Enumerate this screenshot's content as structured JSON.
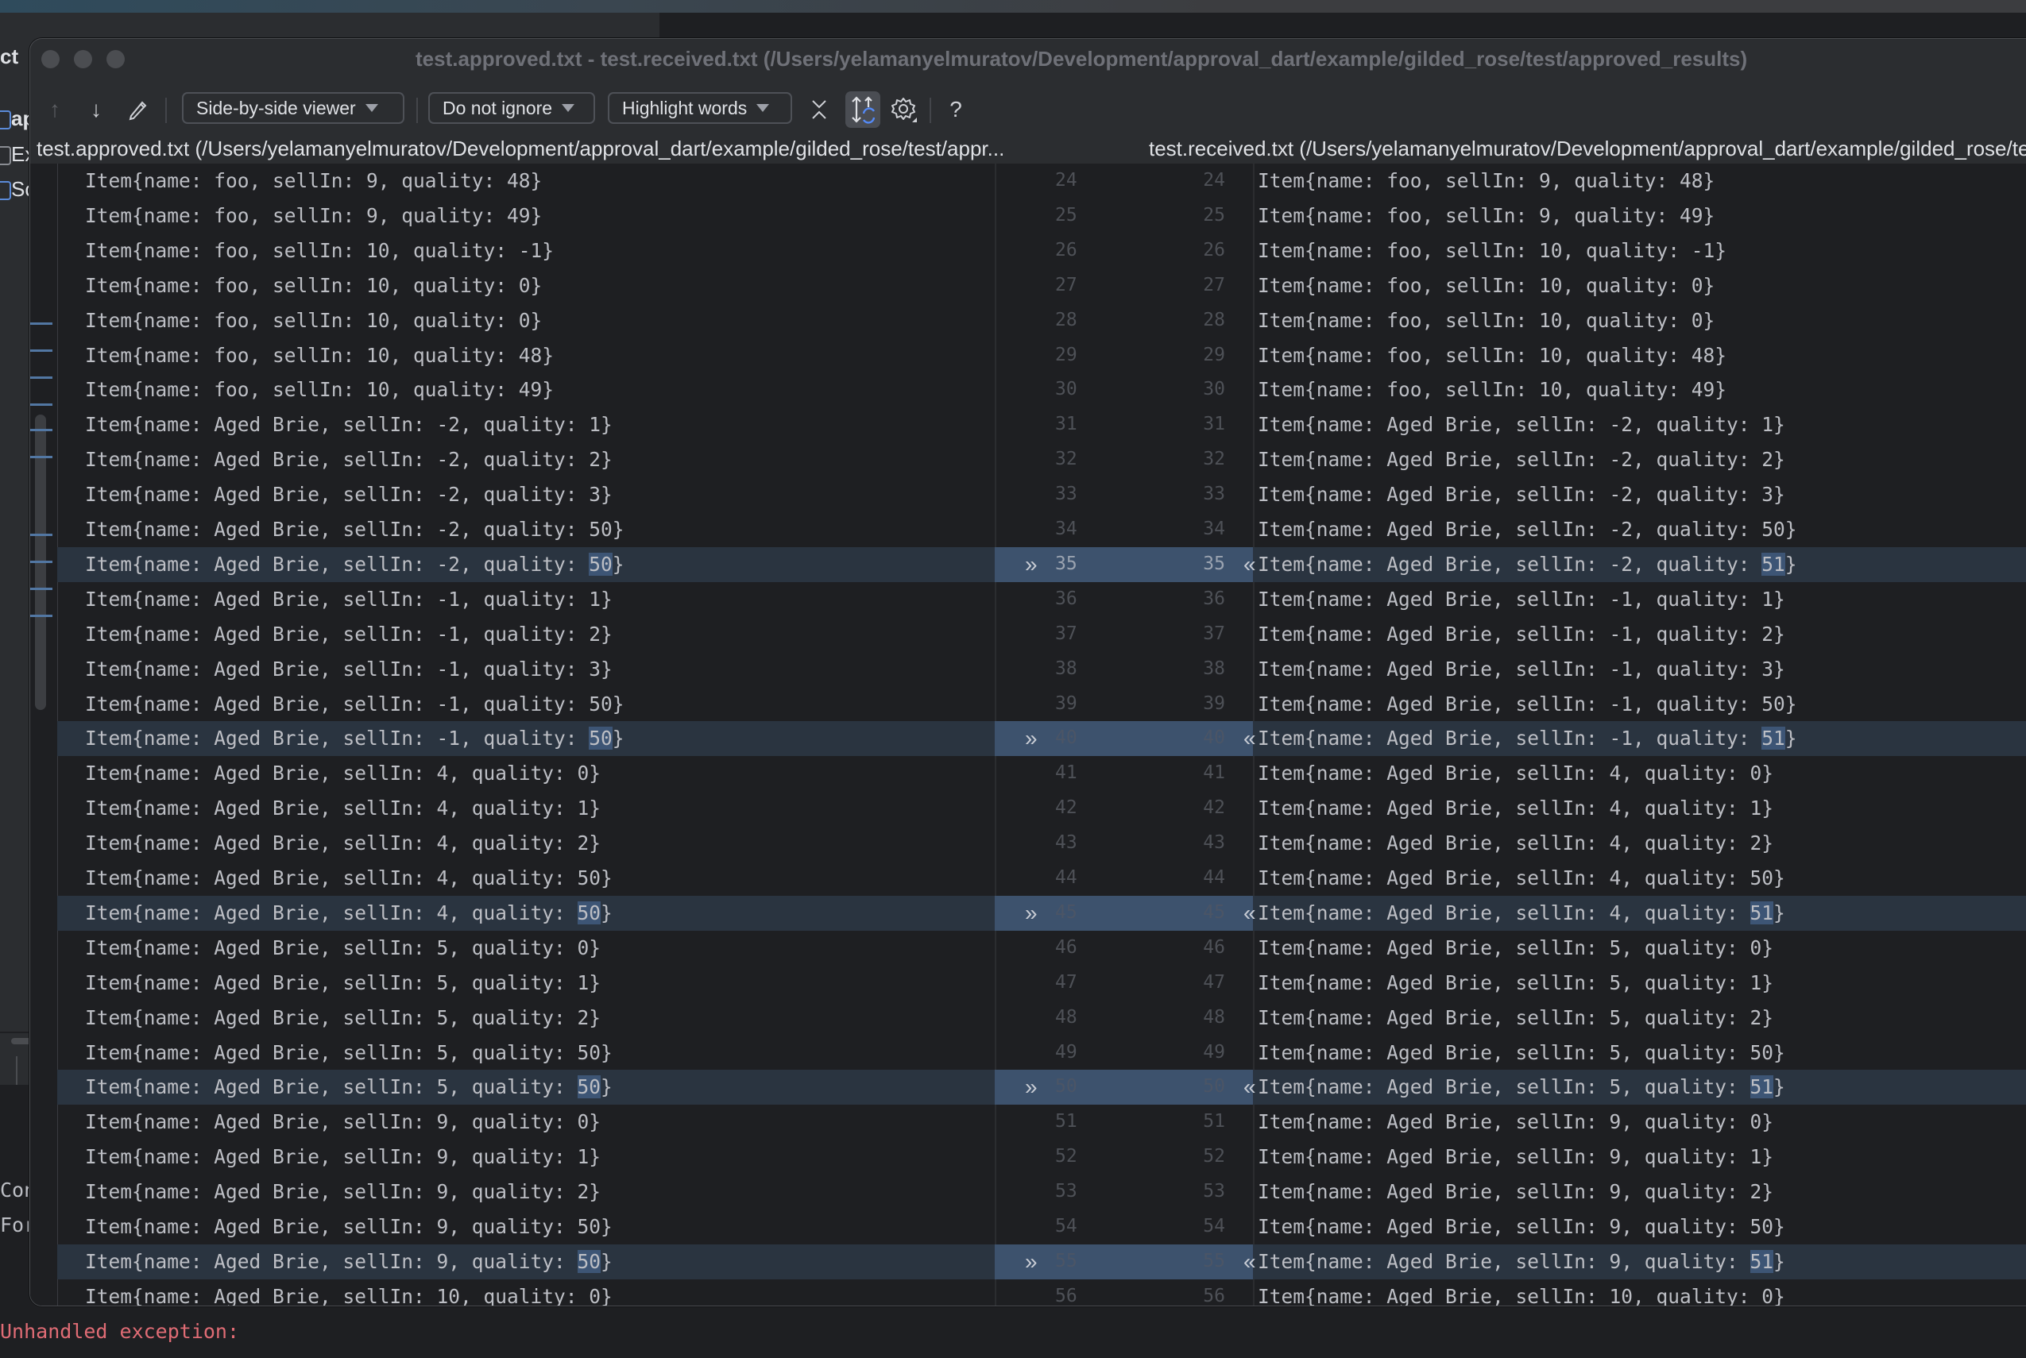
{
  "ide": {
    "project_label": "ct",
    "tree_items": [
      "ap",
      "Ex",
      "Sc"
    ],
    "console_lines": [
      "Con",
      "For"
    ],
    "console_error": "Unhandled exception:"
  },
  "dialog": {
    "title": "test.approved.txt - test.received.txt (/Users/yelamanyelmuratov/Development/approval_dart/example/gilded_rose/test/approved_results)",
    "toolbar": {
      "prev_diff_icon": "arrow-up-icon",
      "next_diff_icon": "arrow-down-icon",
      "edit_icon": "pencil-icon",
      "viewer_mode": "Side-by-side viewer",
      "ignore_mode": "Do not ignore",
      "highlight_mode": "Highlight words",
      "collapse_icon": "collapse-unchanged-icon",
      "sync_scroll_icon": "sync-scroll-icon",
      "sync_scroll_active": true,
      "settings_icon": "gear-icon",
      "help_label": "?"
    },
    "left_header": "test.approved.txt (/Users/yelamanyelmuratov/Development/approval_dart/example/gilded_rose/test/appr...",
    "right_header": "test.received.txt (/Users/yelamanyelmuratov/Development/approval_dart/example/gilded_rose/test/approved_results/test.received.txt)",
    "colors": {
      "changed_line_bg": "#2a3440",
      "changed_gutter_bg": "#3d526d",
      "word_highlight": "#3d5575"
    }
  },
  "rows": [
    {
      "n": 24,
      "left": "Item{name: foo, sellIn: 9, quality: 48}",
      "right": "Item{name: foo, sellIn: 9, quality: 48}",
      "changed": false
    },
    {
      "n": 25,
      "left": "Item{name: foo, sellIn: 9, quality: 49}",
      "right": "Item{name: foo, sellIn: 9, quality: 49}",
      "changed": false
    },
    {
      "n": 26,
      "left": "Item{name: foo, sellIn: 10, quality: -1}",
      "right": "Item{name: foo, sellIn: 10, quality: -1}",
      "changed": false
    },
    {
      "n": 27,
      "left": "Item{name: foo, sellIn: 10, quality: 0}",
      "right": "Item{name: foo, sellIn: 10, quality: 0}",
      "changed": false
    },
    {
      "n": 28,
      "left": "Item{name: foo, sellIn: 10, quality: 0}",
      "right": "Item{name: foo, sellIn: 10, quality: 0}",
      "changed": false
    },
    {
      "n": 29,
      "left": "Item{name: foo, sellIn: 10, quality: 48}",
      "right": "Item{name: foo, sellIn: 10, quality: 48}",
      "changed": false
    },
    {
      "n": 30,
      "left": "Item{name: foo, sellIn: 10, quality: 49}",
      "right": "Item{name: foo, sellIn: 10, quality: 49}",
      "changed": false
    },
    {
      "n": 31,
      "left": "Item{name: Aged Brie, sellIn: -2, quality: 1}",
      "right": "Item{name: Aged Brie, sellIn: -2, quality: 1}",
      "changed": false
    },
    {
      "n": 32,
      "left": "Item{name: Aged Brie, sellIn: -2, quality: 2}",
      "right": "Item{name: Aged Brie, sellIn: -2, quality: 2}",
      "changed": false
    },
    {
      "n": 33,
      "left": "Item{name: Aged Brie, sellIn: -2, quality: 3}",
      "right": "Item{name: Aged Brie, sellIn: -2, quality: 3}",
      "changed": false
    },
    {
      "n": 34,
      "left": "Item{name: Aged Brie, sellIn: -2, quality: 50}",
      "right": "Item{name: Aged Brie, sellIn: -2, quality: 50}",
      "changed": false
    },
    {
      "n": 35,
      "left_prefix": "Item{name: Aged Brie, sellIn: -2, quality: ",
      "left_word": "50",
      "right_prefix": "Item{name: Aged Brie, sellIn: -2, quality: ",
      "right_word": "51",
      "suffix": "}",
      "changed": true,
      "num_visible": true
    },
    {
      "n": 36,
      "left": "Item{name: Aged Brie, sellIn: -1, quality: 1}",
      "right": "Item{name: Aged Brie, sellIn: -1, quality: 1}",
      "changed": false
    },
    {
      "n": 37,
      "left": "Item{name: Aged Brie, sellIn: -1, quality: 2}",
      "right": "Item{name: Aged Brie, sellIn: -1, quality: 2}",
      "changed": false
    },
    {
      "n": 38,
      "left": "Item{name: Aged Brie, sellIn: -1, quality: 3}",
      "right": "Item{name: Aged Brie, sellIn: -1, quality: 3}",
      "changed": false
    },
    {
      "n": 39,
      "left": "Item{name: Aged Brie, sellIn: -1, quality: 50}",
      "right": "Item{name: Aged Brie, sellIn: -1, quality: 50}",
      "changed": false
    },
    {
      "n": 40,
      "left_prefix": "Item{name: Aged Brie, sellIn: -1, quality: ",
      "left_word": "50",
      "right_prefix": "Item{name: Aged Brie, sellIn: -1, quality: ",
      "right_word": "51",
      "suffix": "}",
      "changed": true,
      "num_visible": false
    },
    {
      "n": 41,
      "left": "Item{name: Aged Brie, sellIn: 4, quality: 0}",
      "right": "Item{name: Aged Brie, sellIn: 4, quality: 0}",
      "changed": false
    },
    {
      "n": 42,
      "left": "Item{name: Aged Brie, sellIn: 4, quality: 1}",
      "right": "Item{name: Aged Brie, sellIn: 4, quality: 1}",
      "changed": false
    },
    {
      "n": 43,
      "left": "Item{name: Aged Brie, sellIn: 4, quality: 2}",
      "right": "Item{name: Aged Brie, sellIn: 4, quality: 2}",
      "changed": false
    },
    {
      "n": 44,
      "left": "Item{name: Aged Brie, sellIn: 4, quality: 50}",
      "right": "Item{name: Aged Brie, sellIn: 4, quality: 50}",
      "changed": false
    },
    {
      "n": 45,
      "left_prefix": "Item{name: Aged Brie, sellIn: 4, quality: ",
      "left_word": "50",
      "right_prefix": "Item{name: Aged Brie, sellIn: 4, quality: ",
      "right_word": "51",
      "suffix": "}",
      "changed": true,
      "num_visible": false
    },
    {
      "n": 46,
      "left": "Item{name: Aged Brie, sellIn: 5, quality: 0}",
      "right": "Item{name: Aged Brie, sellIn: 5, quality: 0}",
      "changed": false
    },
    {
      "n": 47,
      "left": "Item{name: Aged Brie, sellIn: 5, quality: 1}",
      "right": "Item{name: Aged Brie, sellIn: 5, quality: 1}",
      "changed": false
    },
    {
      "n": 48,
      "left": "Item{name: Aged Brie, sellIn: 5, quality: 2}",
      "right": "Item{name: Aged Brie, sellIn: 5, quality: 2}",
      "changed": false
    },
    {
      "n": 49,
      "left": "Item{name: Aged Brie, sellIn: 5, quality: 50}",
      "right": "Item{name: Aged Brie, sellIn: 5, quality: 50}",
      "changed": false
    },
    {
      "n": 50,
      "left_prefix": "Item{name: Aged Brie, sellIn: 5, quality: ",
      "left_word": "50",
      "right_prefix": "Item{name: Aged Brie, sellIn: 5, quality: ",
      "right_word": "51",
      "suffix": "}",
      "changed": true,
      "num_visible": false
    },
    {
      "n": 51,
      "left": "Item{name: Aged Brie, sellIn: 9, quality: 0}",
      "right": "Item{name: Aged Brie, sellIn: 9, quality: 0}",
      "changed": false
    },
    {
      "n": 52,
      "left": "Item{name: Aged Brie, sellIn: 9, quality: 1}",
      "right": "Item{name: Aged Brie, sellIn: 9, quality: 1}",
      "changed": false
    },
    {
      "n": 53,
      "left": "Item{name: Aged Brie, sellIn: 9, quality: 2}",
      "right": "Item{name: Aged Brie, sellIn: 9, quality: 2}",
      "changed": false
    },
    {
      "n": 54,
      "left": "Item{name: Aged Brie, sellIn: 9, quality: 50}",
      "right": "Item{name: Aged Brie, sellIn: 9, quality: 50}",
      "changed": false
    },
    {
      "n": 55,
      "left_prefix": "Item{name: Aged Brie, sellIn: 9, quality: ",
      "left_word": "50",
      "right_prefix": "Item{name: Aged Brie, sellIn: 9, quality: ",
      "right_word": "51",
      "suffix": "}",
      "changed": true,
      "num_visible": false
    },
    {
      "n": 56,
      "left": "Item{name: Aged Brie, sellIn: 10, quality: 0}",
      "right": "Item{name: Aged Brie, sellIn: 10, quality: 0}",
      "changed": false
    }
  ]
}
